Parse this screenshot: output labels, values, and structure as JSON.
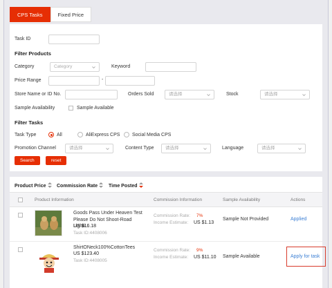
{
  "tabs": [
    {
      "label": "CPS Tasks",
      "active": true
    },
    {
      "label": "Fixed Price",
      "active": false
    }
  ],
  "filters": {
    "task_id_label": "Task ID",
    "filter_products_title": "Filter Products",
    "category_label": "Category",
    "category_placeholder": "Category",
    "keyword_label": "Keyword",
    "price_range_label": "Price Range",
    "price_separator": "-",
    "store_label": "Store Name or ID No.",
    "orders_sold_label": "Orders Sold",
    "orders_sold_placeholder": "请选择",
    "stock_label": "Stock",
    "stock_placeholder": "请选择",
    "sample_availability_label": "Sample Availability",
    "sample_available_label": "Sample Available",
    "filter_tasks_title": "Filter Tasks",
    "task_type_label": "Task Type",
    "task_types": [
      "All",
      "AliExpress CPS",
      "Social Media CPS"
    ],
    "task_type_selected": "All",
    "promotion_channel_label": "Promotion Channel",
    "promotion_channel_placeholder": "请选择",
    "content_type_label": "Content Type",
    "content_type_placeholder": "请选择",
    "language_label": "Language",
    "language_placeholder": "请选择",
    "search_button": "Search",
    "reset_button": "reset"
  },
  "sort": {
    "product_price": "Product Price",
    "commission_rate": "Commission Rate",
    "time_posted": "Time Posted"
  },
  "table": {
    "headers": [
      "Product Information",
      "Commission Information",
      "Sample Availability",
      "Actions"
    ],
    "rows": [
      {
        "name": "Goods Pass Under Heaven Test Please Do Not Shoot-Road Lighti...",
        "price": "US $16.18",
        "task_id": "Task ID:4408006",
        "commission_rate_label": "Commission Rate:",
        "commission_rate": "7%",
        "income_label": "Income Estimate:",
        "income": "US $1.13",
        "sample": "Sample Not Provided",
        "action": "Applied",
        "image": "dogs-photo"
      },
      {
        "name": "ShirtONeck100%CottonTees",
        "price": "US $123.40",
        "task_id": "Task ID:4408005",
        "commission_rate_label": "Commission Rate:",
        "commission_rate": "9%",
        "income_label": "Income Estimate:",
        "income": "US $11.10",
        "sample": "Sample Available",
        "action": "Apply for task",
        "image": "cartoon-character"
      }
    ]
  },
  "colors": {
    "accent": "#e62e04",
    "link": "#3b7fd4",
    "highlight": "#d83a2a"
  }
}
